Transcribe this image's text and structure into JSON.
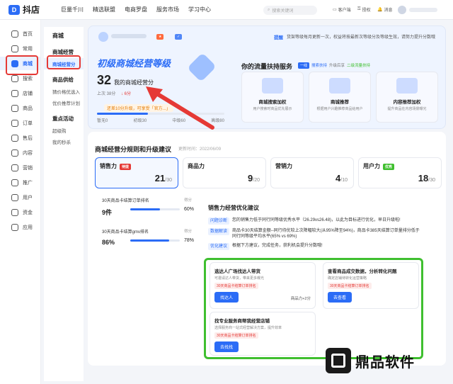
{
  "app": {
    "logo": "抖店"
  },
  "topnav": [
    "巨量千川",
    "精选联盟",
    "电商罗盘",
    "服务市场",
    "学习中心"
  ],
  "search": {
    "placeholder": "搜索关键词"
  },
  "topright": [
    "客户端",
    "授权",
    "消息"
  ],
  "sidebar": [
    {
      "label": "首页",
      "icon": "home-icon"
    },
    {
      "label": "常用",
      "icon": "star-icon"
    },
    {
      "label": "商城",
      "icon": "mall-icon",
      "active": true
    },
    {
      "label": "搜索",
      "icon": "search-icon"
    },
    {
      "label": "店铺",
      "icon": "shop-icon"
    },
    {
      "label": "商品",
      "icon": "goods-icon"
    },
    {
      "label": "订单",
      "icon": "order-icon"
    },
    {
      "label": "售后",
      "icon": "aftersale-icon"
    },
    {
      "label": "内容",
      "icon": "content-icon"
    },
    {
      "label": "营销",
      "icon": "marketing-icon"
    },
    {
      "label": "推广",
      "icon": "promote-icon"
    },
    {
      "label": "用户",
      "icon": "user-icon"
    },
    {
      "label": "资金",
      "icon": "fund-icon"
    },
    {
      "label": "应用",
      "icon": "app-icon"
    }
  ],
  "submenu": {
    "title": "商城",
    "items": [
      {
        "label": "商城经营",
        "type": "head"
      },
      {
        "label": "商城经营分",
        "type": "sel"
      },
      {
        "label": "商品供给",
        "type": "head"
      },
      {
        "label": "猜价格优选入",
        "type": "item"
      },
      {
        "label": "优价推荐计划",
        "type": "item"
      },
      {
        "label": "重点活动",
        "type": "head"
      },
      {
        "label": "超级购",
        "type": "item"
      },
      {
        "label": "我的秒杀",
        "type": "item"
      }
    ]
  },
  "notice": {
    "tag": "提醒",
    "text": "货架等级每月更新一次，权益将按最新次等级分及等级生效，请努力提升分数哦"
  },
  "level": {
    "title": "初级商城经营等级",
    "score": "32",
    "score_label": "我的商城经营分",
    "prev": "上次 38分",
    "delta": "↓ 6分",
    "hint": "还差10分升级，可享受「官方...」",
    "levels": [
      "暂无0",
      "初级30",
      "中级60",
      "高级80"
    ],
    "progress": 0.4
  },
  "support": {
    "title": "你的流量扶持服务",
    "tags": [
      "一线",
      "搜索扶持",
      "升级后享",
      "二级流量扶持"
    ],
    "items": [
      {
        "title": "商城搜索加权",
        "sub": "用户搜索时商品优先展示"
      },
      {
        "title": "商城推荐",
        "sub": "根据用户兴趣推荐商品给用户"
      },
      {
        "title": "内容推荐加权",
        "sub": "提升商品在内容场景曝光"
      }
    ]
  },
  "rules": {
    "title": "商城经营分规则和升级建议",
    "sub": "更新时间：2022/06/09"
  },
  "metrics": [
    {
      "label": "销售力",
      "tag": "待提",
      "score": "21",
      "total": "/30"
    },
    {
      "label": "商品力",
      "tag": "",
      "score": "9",
      "total": "/20"
    },
    {
      "label": "营销力",
      "tag": "",
      "score": "4",
      "total": "/10"
    },
    {
      "label": "用户力",
      "tag": "优秀",
      "score": "18",
      "total": "/30"
    }
  ],
  "detail": [
    {
      "label": "30天商品卡结算订单排名",
      "value": "9件",
      "right_label": "得分",
      "right": "60%",
      "progress": 0.6
    },
    {
      "label": "30天商品卡结算gmv排名",
      "value": "86%",
      "right_label": "得分",
      "right": "78%",
      "progress": 0.78
    }
  ],
  "advice": {
    "title": "销售力经营优化建议",
    "rows": [
      {
        "tag": "问题诊断",
        "text": "您的销售力低于同行同等级优秀水平（26.29vs26.48)，以此为目标进行优化，早日升级啦!"
      },
      {
        "tag": "数据解读",
        "text": "商品卡30天结算金额--同行待优较上次降幅较大(从95%降至94%)，商品卡385天结算订单量排分低于同行同等级平均水平(65% vs 69%)"
      },
      {
        "tag": "优化建议",
        "text": "根据下方建议，完成任务，获利机会提升分数哦!"
      }
    ]
  },
  "tasks": [
    {
      "title": "选达人广场找达人带货",
      "sub": "可邀请达人带货，带来更多曝光",
      "chip": "30天商品卡结算订单排名",
      "btn": "找达人",
      "extra": "商品力+2分"
    },
    {
      "title": "查看商品成交数据，分析转化问题",
      "sub": "确定店铺待转化运营策略",
      "chip": "30天商品卡结算订单排名",
      "btn": "去查看"
    },
    {
      "title": "找专业服务商帮我经营店铺",
      "sub": "选择服务商一站式经营解决方案，提升效率",
      "chip": "30天商品卡结算订单排名",
      "btn": "去找找"
    }
  ],
  "watermark": "鼎品软件",
  "colors": {
    "accent": "#2b6cf6",
    "highlight_red": "#e53935",
    "highlight_green": "#3fbf2f"
  }
}
